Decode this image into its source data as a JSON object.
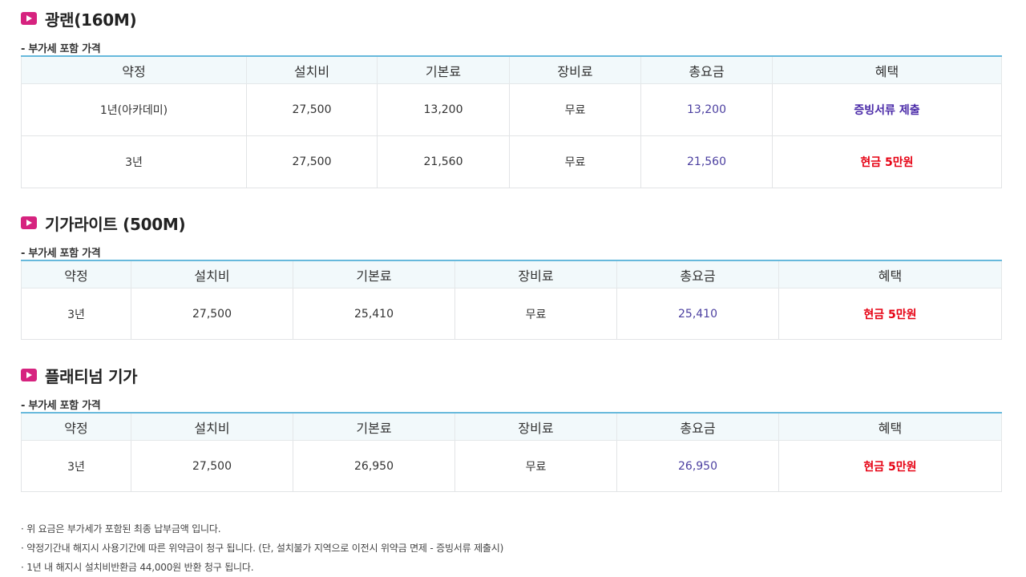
{
  "colors": {
    "icon_bg": "#d6237f",
    "header_border": "#67b9dc",
    "header_bg": "#f2f9fb",
    "total_text": "#4b3fa0",
    "benefit_purple": "#4a2aa8",
    "benefit_red": "#e60012"
  },
  "icon": "play-icon",
  "sections": [
    {
      "title": "광랜(160M)",
      "vat_label": "- 부가세 포함 가격",
      "headers": [
        "약정",
        "설치비",
        "기본료",
        "장비료",
        "총요금",
        "혜택"
      ],
      "rows": [
        {
          "term": "1년(아카데미)",
          "install": "27,500",
          "base": "13,200",
          "equipment": "무료",
          "total": "13,200",
          "benefit": "증빙서류 제출",
          "benefit_color": "#4a2aa8"
        },
        {
          "term": "3년",
          "install": "27,500",
          "base": "21,560",
          "equipment": "무료",
          "total": "21,560",
          "benefit": "현금 5만원",
          "benefit_color": "#e60012"
        }
      ]
    },
    {
      "title": "기가라이트 (500M)",
      "vat_label": "- 부가세 포함 가격",
      "headers": [
        "약정",
        "설치비",
        "기본료",
        "장비료",
        "총요금",
        "혜택"
      ],
      "rows": [
        {
          "term": "3년",
          "install": "27,500",
          "base": "25,410",
          "equipment": "무료",
          "total": "25,410",
          "benefit": "현금 5만원",
          "benefit_color": "#e60012"
        }
      ]
    },
    {
      "title": "플래티넘 기가",
      "vat_label": "- 부가세 포함 가격",
      "headers": [
        "약정",
        "설치비",
        "기본료",
        "장비료",
        "총요금",
        "혜택"
      ],
      "rows": [
        {
          "term": "3년",
          "install": "27,500",
          "base": "26,950",
          "equipment": "무료",
          "total": "26,950",
          "benefit": "현금 5만원",
          "benefit_color": "#e60012"
        }
      ]
    }
  ],
  "notes": [
    "· 위 요금은 부가세가 포함된 최종 납부금액 입니다.",
    "· 약정기간내 해지시 사용기간에 따른 위약금이 청구 됩니다. (단, 설치불가 지역으로 이전시 위약금 면제 - 증빙서류 제출시)",
    "· 1년 내 해지시 설치비반환금 44,000원 반환 청구 됩니다."
  ]
}
